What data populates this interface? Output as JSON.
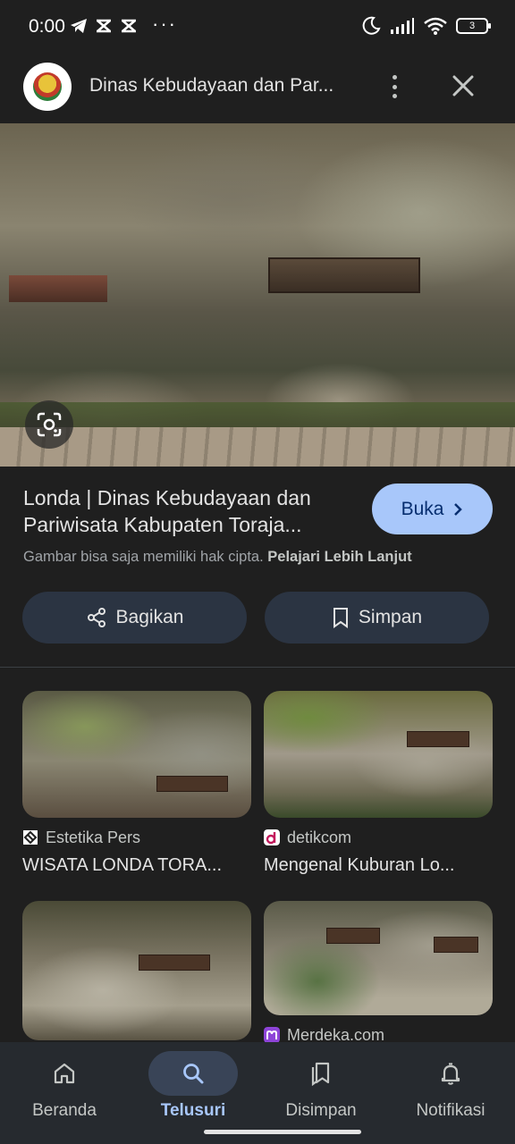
{
  "status_bar": {
    "time": "0:00",
    "battery": "3",
    "dots": "···"
  },
  "header": {
    "site_title": "Dinas Kebudayaan dan Par...",
    "logo_icon": "regency-emblem-icon",
    "more_icon": "more-vert-icon",
    "close_icon": "close-icon"
  },
  "result": {
    "title": "Londa | Dinas Kebudayaan dan Pariwisata Kabupaten Toraja...",
    "open_label": "Buka",
    "copyright_text": "Gambar bisa saja memiliki hak cipta.",
    "learn_more": "Pelajari Lebih Lanjut",
    "share_label": "Bagikan",
    "save_label": "Simpan"
  },
  "related": [
    {
      "source": "Estetika Pers",
      "title": "WISATA LONDA TORA...",
      "favicon_color": "#ffffff"
    },
    {
      "source": "detikcom",
      "title": "Mengenal Kuburan Lo...",
      "favicon_color": "#ffffff"
    },
    {
      "source": "",
      "title": "",
      "favicon_color": ""
    },
    {
      "source": "Merdeka.com",
      "title": "",
      "favicon_color": "#8e44d8"
    }
  ],
  "nav": {
    "items": [
      {
        "label": "Beranda",
        "icon": "home-icon"
      },
      {
        "label": "Telusuri",
        "icon": "search-icon",
        "active": true
      },
      {
        "label": "Disimpan",
        "icon": "collections-icon"
      },
      {
        "label": "Notifikasi",
        "icon": "bell-icon"
      }
    ]
  },
  "colors": {
    "background": "#1f1f1f",
    "accent": "#a8c7fa",
    "button_bg": "#2b3442"
  }
}
